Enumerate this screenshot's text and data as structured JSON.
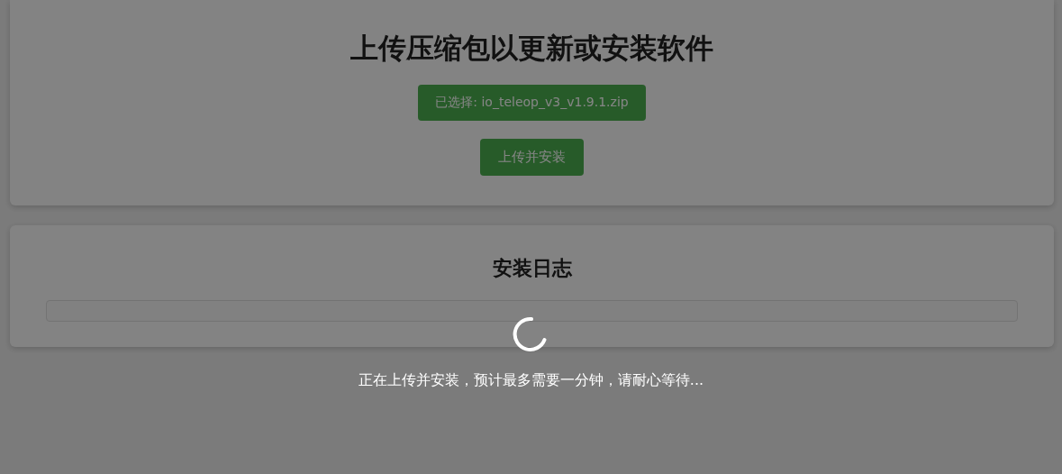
{
  "upload_card": {
    "title": "上传压缩包以更新或安装软件",
    "file_button": "已选择: io_teleop_v3_v1.9.1.zip",
    "upload_button": "上传并安装"
  },
  "log_card": {
    "title": "安装日志"
  },
  "loading_overlay": {
    "message": "正在上传并安装，预计最多需要一分钟，请耐心等待..."
  }
}
